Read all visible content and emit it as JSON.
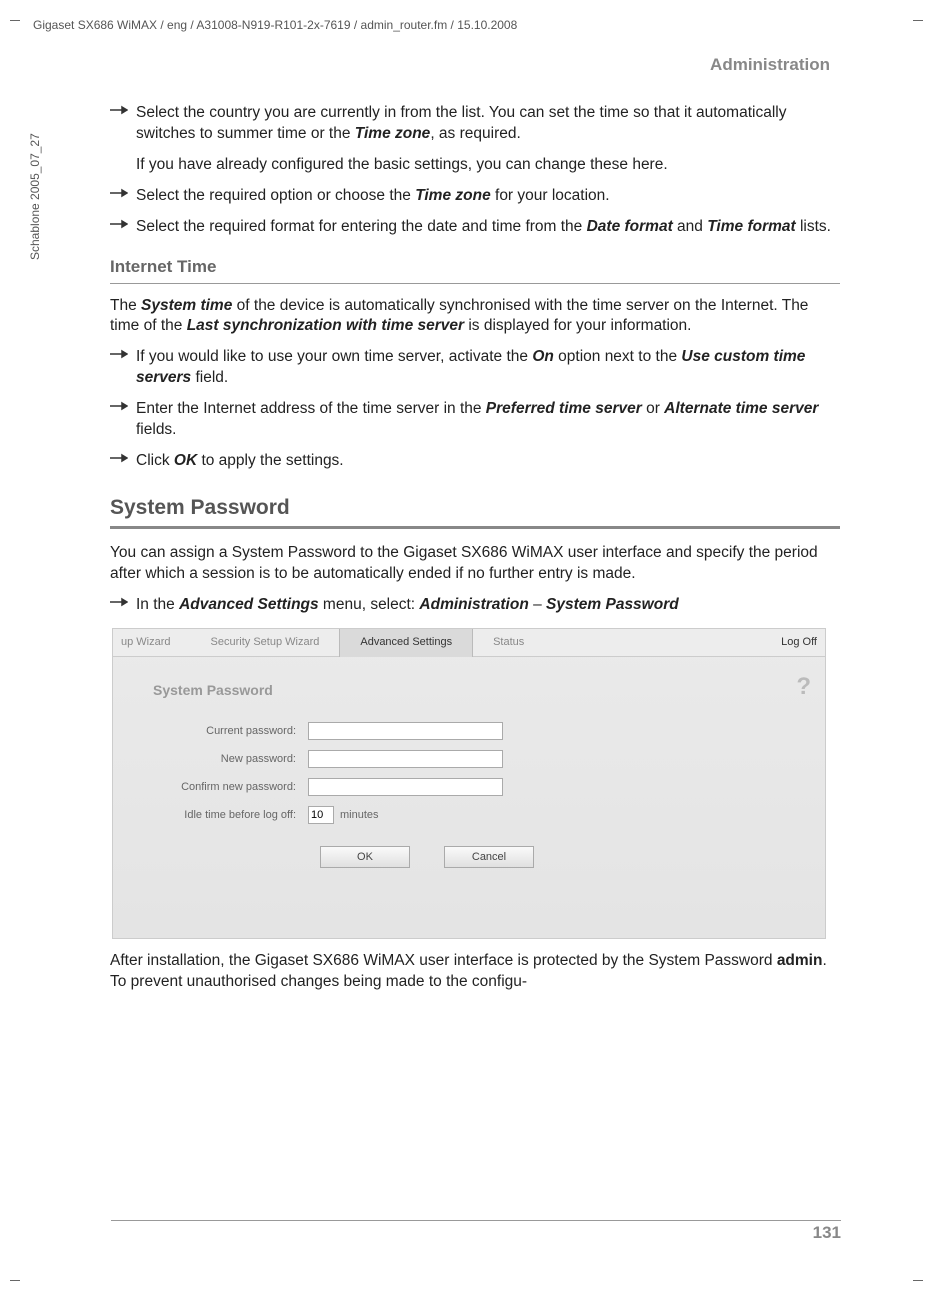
{
  "header": {
    "breadcrumb": "Gigaset SX686 WiMAX / eng / A31008-N919-R101-2x-7619 / admin_router.fm / 15.10.2008",
    "sidebar": "Schablone 2005_07_27",
    "section": "Administration"
  },
  "body": {
    "p1a": "Select the country you are currently in from the list. You can set the time so that it automatically switches to summer time or the ",
    "p1b": "Time zone",
    "p1c": ", as required.",
    "p2": "If you have already configured the basic settings, you can change these here.",
    "p3a": "Select the required option or choose the ",
    "p3b": "Time zone",
    "p3c": " for your location.",
    "p4a": "Select the required format for entering the date and time from the ",
    "p4b": "Date format",
    "p4c": " and ",
    "p4d": "Time format",
    "p4e": " lists.",
    "h_internet_time": "Internet Time",
    "p5a": "The ",
    "p5b": "System time",
    "p5c": " of the device is automatically synchronised with the time server on the Internet. The time of the ",
    "p5d": "Last synchronization with time server",
    "p5e": " is displayed for your information.",
    "p6a": "If you would like to use your own time server, activate the ",
    "p6b": "On",
    "p6c": " option next to the ",
    "p6d": "Use custom time servers",
    "p6e": " field.",
    "p7a": "Enter the Internet address of the time server in the ",
    "p7b": "Preferred time server",
    "p7c": " or ",
    "p7d": "Alternate time server",
    "p7e": " fields.",
    "p8a": "Click ",
    "p8b": "OK",
    "p8c": " to apply the settings.",
    "h_syspass": "System Password",
    "p9": "You can assign a System Password to the Gigaset SX686 WiMAX user interface and specify the period after which a session is to be automatically ended if no further entry is made.",
    "p10a": "In the ",
    "p10b": "Advanced Settings",
    "p10c": " menu, select: ",
    "p10d": "Administration",
    "p10e": " – ",
    "p10f": "System Password",
    "p11a": "After installation, the Gigaset SX686 WiMAX user interface is protected by the System Password ",
    "p11b": "admin",
    "p11c": ". To prevent unauthorised changes being made to the configu-"
  },
  "screenshot": {
    "tabs": {
      "wizard": "up Wizard",
      "security": "Security Setup Wizard",
      "advanced": "Advanced Settings",
      "status": "Status"
    },
    "logoff": "Log Off",
    "title": "System Password",
    "help": "?",
    "labels": {
      "current": "Current password:",
      "newpw": "New password:",
      "confirm": "Confirm new password:",
      "idle": "Idle time before log off:"
    },
    "values": {
      "current": "",
      "newpw": "",
      "confirm": "",
      "idle": "10",
      "unit": "minutes"
    },
    "buttons": {
      "ok": "OK",
      "cancel": "Cancel"
    }
  },
  "page_number": "131"
}
